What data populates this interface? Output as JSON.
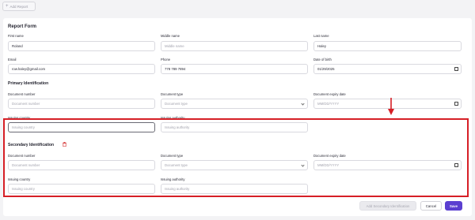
{
  "toolbar": {
    "add_report_label": "Add Report"
  },
  "form": {
    "title": "Report Form",
    "first_name": {
      "label": "First name",
      "value": "Roland"
    },
    "middle_name": {
      "label": "Middle name",
      "placeholder": "Middle name"
    },
    "last_name": {
      "label": "Last name",
      "value": "Haley"
    },
    "email": {
      "label": "Email",
      "value": "row.haley@gmail.com"
    },
    "phone": {
      "label": "Phone",
      "value": "778 789 7894"
    },
    "dob": {
      "label": "Date of birth",
      "value": "01/29/2025"
    }
  },
  "primary": {
    "title": "Primary Identification",
    "doc_number": {
      "label": "Document number",
      "placeholder": "Document number"
    },
    "doc_type": {
      "label": "Document type",
      "placeholder": "Document type"
    },
    "doc_expiry": {
      "label": "Document expiry date",
      "placeholder": "MM/DD/YYYY"
    },
    "issuing_country": {
      "label": "Issuing country",
      "placeholder": "Issuing country"
    },
    "issuing_authority": {
      "label": "Issuing authority",
      "placeholder": "Issuing authority"
    }
  },
  "secondary": {
    "title": "Secondary Identification",
    "doc_number": {
      "label": "Document number",
      "placeholder": "Document number"
    },
    "doc_type": {
      "label": "Document type",
      "placeholder": "Document type"
    },
    "doc_expiry": {
      "label": "Document expiry date",
      "placeholder": "MM/DD/YYYY"
    },
    "issuing_country": {
      "label": "Issuing country",
      "placeholder": "Issuing country"
    },
    "issuing_authority": {
      "label": "Issuing authority",
      "placeholder": "Issuing authority"
    }
  },
  "actions": {
    "add_secondary_label": "Add Secondary Identification",
    "cancel_label": "Cancel",
    "save_label": "Save"
  },
  "colors": {
    "accent": "#5b3fd0",
    "highlight": "#d61f26",
    "delete_icon": "#d63a3a"
  },
  "icons": [
    "plus-icon",
    "calendar-icon",
    "chevron-down-icon",
    "trash-icon",
    "arrow-down-icon"
  ]
}
